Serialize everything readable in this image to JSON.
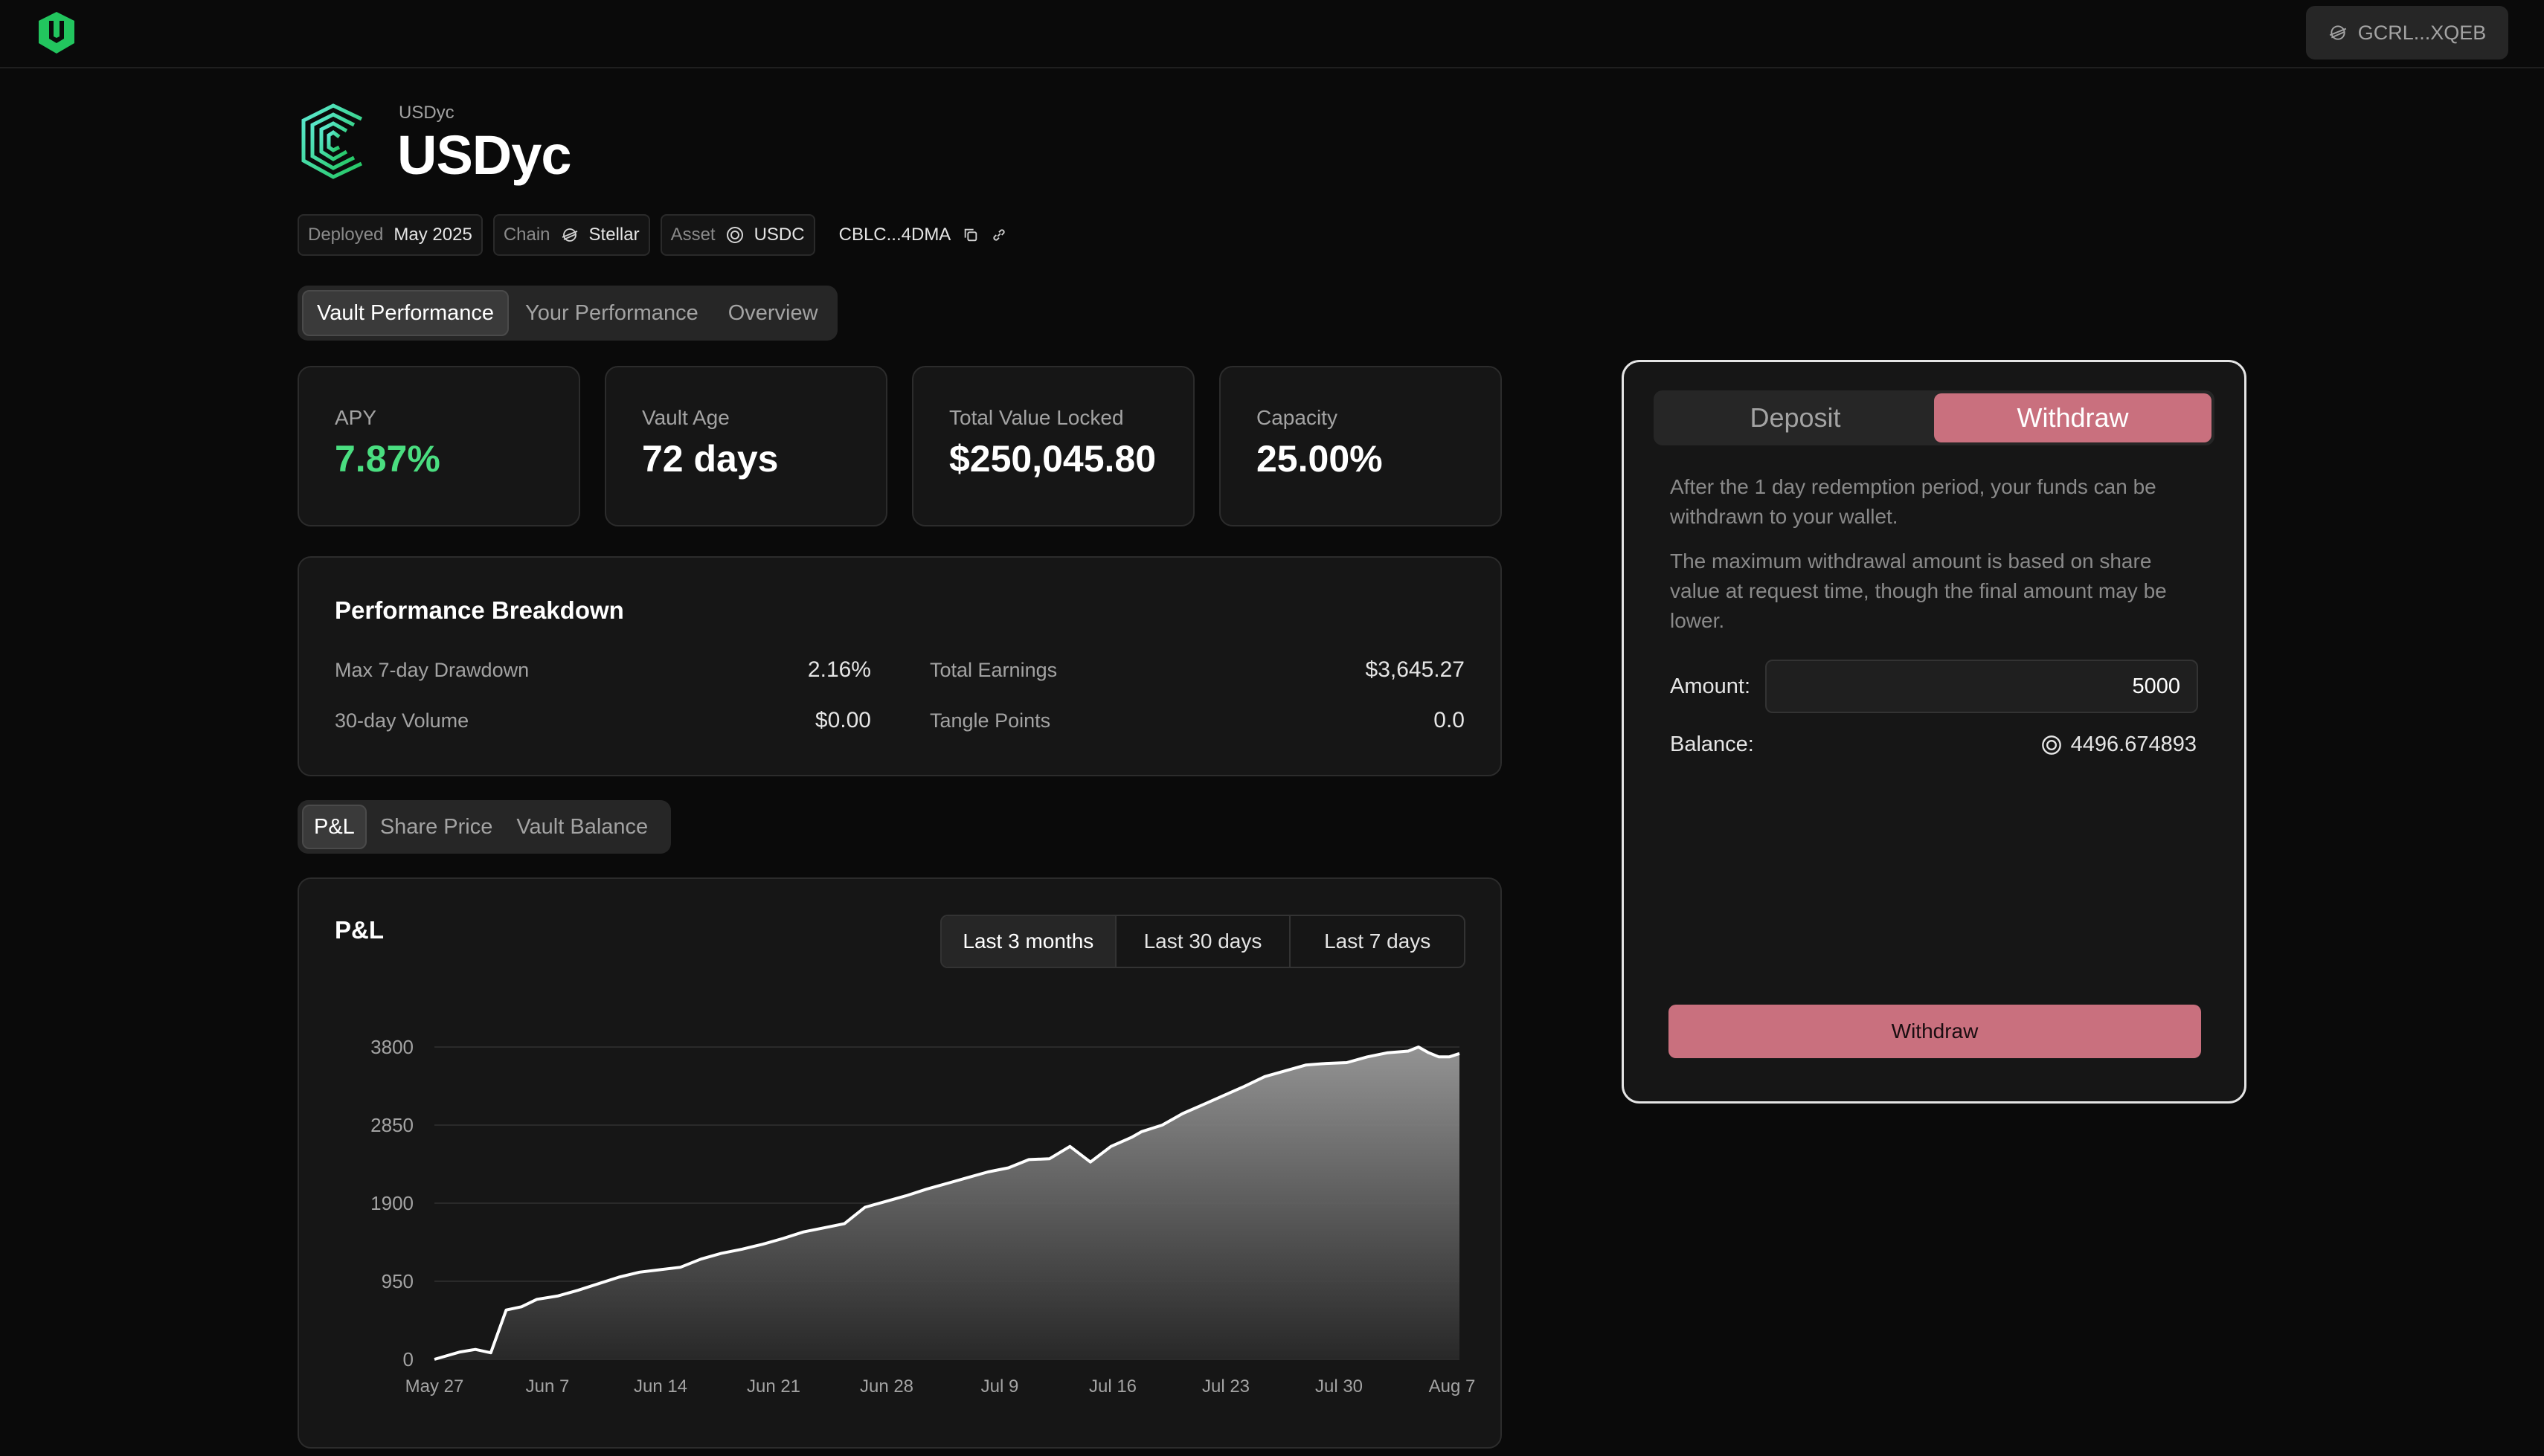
{
  "topbar": {
    "wallet_address": "GCRL...XQEB",
    "wallet_icon": "stellar-icon"
  },
  "vault": {
    "subtitle": "USDyc",
    "title": "USDyc",
    "meta": {
      "deployed_label": "Deployed",
      "deployed_value": "May 2025",
      "chain_label": "Chain",
      "chain_value": "Stellar",
      "asset_label": "Asset",
      "asset_value": "USDC",
      "contract_address": "CBLC...4DMA"
    }
  },
  "main_tabs": [
    "Vault Performance",
    "Your Performance",
    "Overview"
  ],
  "stats": [
    {
      "label": "APY",
      "value": "7.87%",
      "color": "#4ade80"
    },
    {
      "label": "Vault Age",
      "value": "72 days",
      "color": "#ffffff"
    },
    {
      "label": "Total Value Locked",
      "value": "$250,045.80",
      "color": "#ffffff"
    },
    {
      "label": "Capacity",
      "value": "25.00%",
      "color": "#ffffff"
    }
  ],
  "performance_breakdown": {
    "title": "Performance Breakdown",
    "rows": [
      {
        "label": "Max 7-day Drawdown",
        "value": "2.16%"
      },
      {
        "label": "Total Earnings",
        "value": "$3,645.27"
      },
      {
        "label": "30-day Volume",
        "value": "$0.00"
      },
      {
        "label": "Tangle Points",
        "value": "0.0"
      }
    ]
  },
  "chart_tabs": [
    "P&L",
    "Share Price",
    "Vault Balance"
  ],
  "chart_card": {
    "title": "P&L",
    "ranges": [
      "Last 3 months",
      "Last 30 days",
      "Last 7 days"
    ]
  },
  "chart_data": {
    "type": "area",
    "title": "P&L",
    "y_ticks": [
      "0",
      "950",
      "1900",
      "2850",
      "3800"
    ],
    "ylim": [
      0,
      3800
    ],
    "x_ticks": [
      "May 27",
      "Jun 7",
      "Jun 14",
      "Jun 21",
      "Jun 28",
      "Jul 9",
      "Jul 16",
      "Jul 23",
      "Jul 30",
      "Aug 7"
    ],
    "x": [
      0,
      0.025,
      0.04,
      0.055,
      0.07,
      0.085,
      0.1,
      0.12,
      0.14,
      0.16,
      0.18,
      0.2,
      0.22,
      0.24,
      0.26,
      0.28,
      0.3,
      0.32,
      0.34,
      0.36,
      0.38,
      0.4,
      0.42,
      0.44,
      0.46,
      0.48,
      0.5,
      0.52,
      0.54,
      0.56,
      0.58,
      0.6,
      0.62,
      0.64,
      0.66,
      0.68,
      0.69,
      0.7,
      0.71,
      0.72,
      0.73,
      0.75,
      0.77,
      0.79,
      0.81,
      0.83,
      0.85,
      0.87,
      0.89,
      0.91,
      0.93,
      0.95,
      0.96,
      0.97,
      0.98,
      0.99,
      1.0
    ],
    "y": [
      0,
      90,
      120,
      80,
      600,
      640,
      730,
      770,
      840,
      920,
      1000,
      1060,
      1090,
      1120,
      1220,
      1290,
      1340,
      1400,
      1470,
      1550,
      1600,
      1650,
      1850,
      1920,
      1990,
      2070,
      2140,
      2210,
      2280,
      2330,
      2430,
      2440,
      2590,
      2400,
      2590,
      2700,
      2770,
      2810,
      2850,
      2920,
      2990,
      3100,
      3210,
      3320,
      3440,
      3510,
      3580,
      3600,
      3610,
      3680,
      3730,
      3750,
      3800,
      3730,
      3680,
      3680,
      3720
    ],
    "grid": true,
    "legend": "none"
  },
  "panel": {
    "tabs": [
      "Deposit",
      "Withdraw"
    ],
    "active_tab": "Withdraw",
    "text1": "After the 1 day redemption period, your funds can be withdrawn to your wallet.",
    "text2": "The maximum withdrawal amount is based on share value at request time, though the final amount may be lower.",
    "amount_label": "Amount:",
    "amount_value": "5000",
    "balance_label": "Balance:",
    "balance_value": "4496.674893",
    "button_label": "Withdraw",
    "accent": "#c9707e"
  }
}
